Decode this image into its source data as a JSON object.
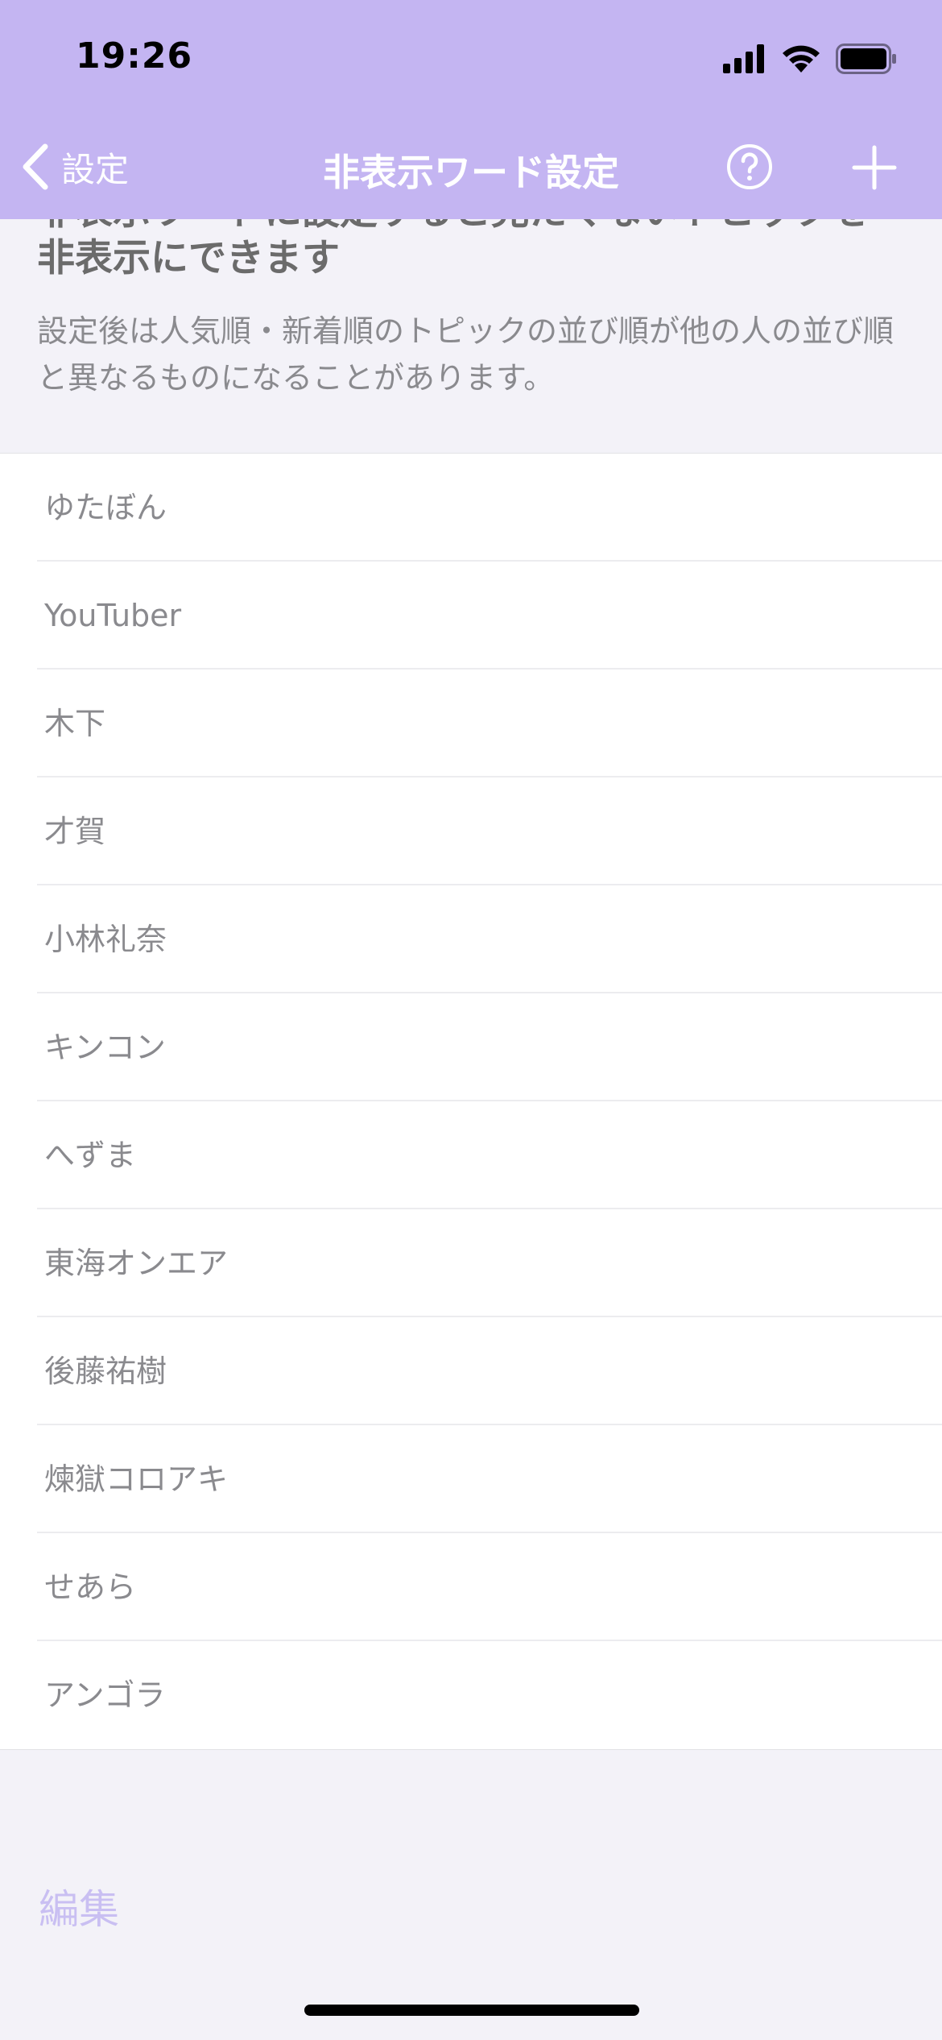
{
  "status_bar": {
    "time": "19:26"
  },
  "nav": {
    "back_label": "設定",
    "title": "非表示ワード設定",
    "help_icon": "question-circle-icon",
    "add_icon": "plus-icon"
  },
  "description": {
    "heading_line1": "非表示ワードに設定すると見たくないトピックを",
    "heading_line2": "非表示にできます",
    "body": "設定後は人気順・新着順のトピックの並び順が他の人の並び順と異なるものになることがあります。"
  },
  "hidden_words": [
    {
      "label": "ゆたぼん"
    },
    {
      "label": "YouTuber"
    },
    {
      "label": "木下"
    },
    {
      "label": "才賀"
    },
    {
      "label": "小林礼奈"
    },
    {
      "label": "キンコン"
    },
    {
      "label": "へずま"
    },
    {
      "label": "東海オンエア"
    },
    {
      "label": "後藤祐樹"
    },
    {
      "label": "煉獄コロアキ"
    },
    {
      "label": "せあら"
    },
    {
      "label": "アンゴラ"
    }
  ],
  "footer": {
    "edit_label": "編集"
  },
  "colors": {
    "header_bg": "#c4b5f2",
    "page_bg": "#f3f2f8",
    "edit_text": "#c9bff2"
  }
}
